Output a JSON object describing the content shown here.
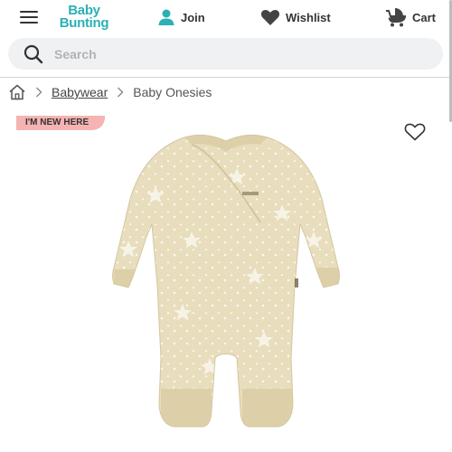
{
  "header": {
    "logo_line1": "Baby",
    "logo_line2": "Bunting",
    "join_label": "Join",
    "wishlist_label": "Wishlist",
    "cart_label": "Cart"
  },
  "search": {
    "placeholder": "Search"
  },
  "breadcrumb": {
    "items": [
      "Babywear",
      "Baby Onesies"
    ]
  },
  "product": {
    "badge": "I'M NEW HERE"
  },
  "colors": {
    "brand": "#2bb0b6",
    "badge": "#f5b3b3",
    "onesie": "#e8ddbc"
  }
}
